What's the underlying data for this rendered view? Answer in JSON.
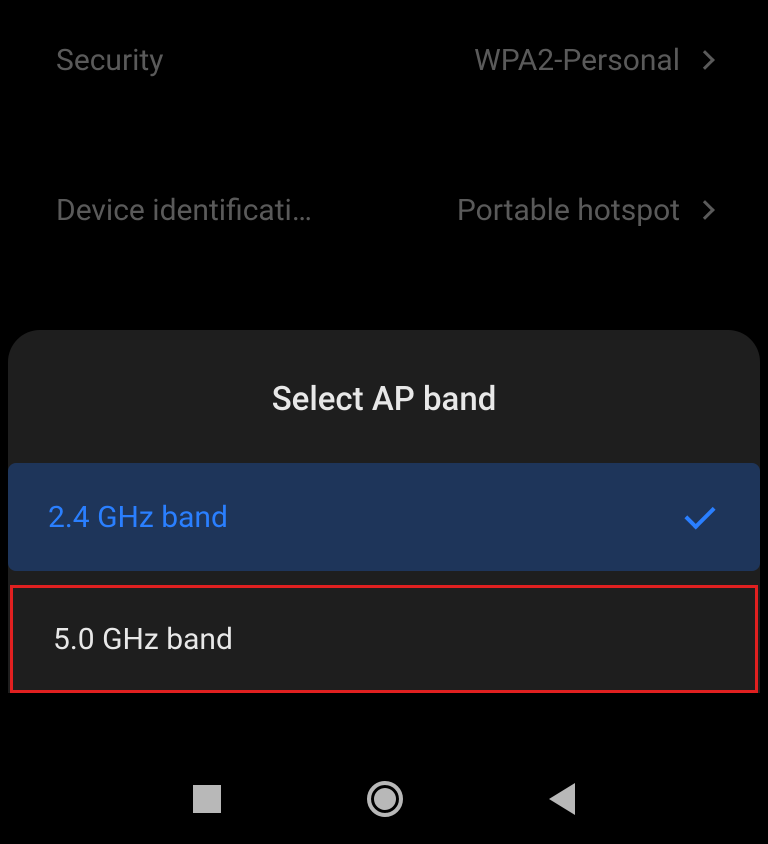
{
  "settings": {
    "security": {
      "label": "Security",
      "value": "WPA2-Personal"
    },
    "device_id": {
      "label": "Device identificati…",
      "value": "Portable hotspot"
    }
  },
  "modal": {
    "title": "Select AP band",
    "options": [
      {
        "label": "2.4 GHz band",
        "selected": true
      },
      {
        "label": "5.0 GHz band",
        "selected": false
      }
    ]
  }
}
